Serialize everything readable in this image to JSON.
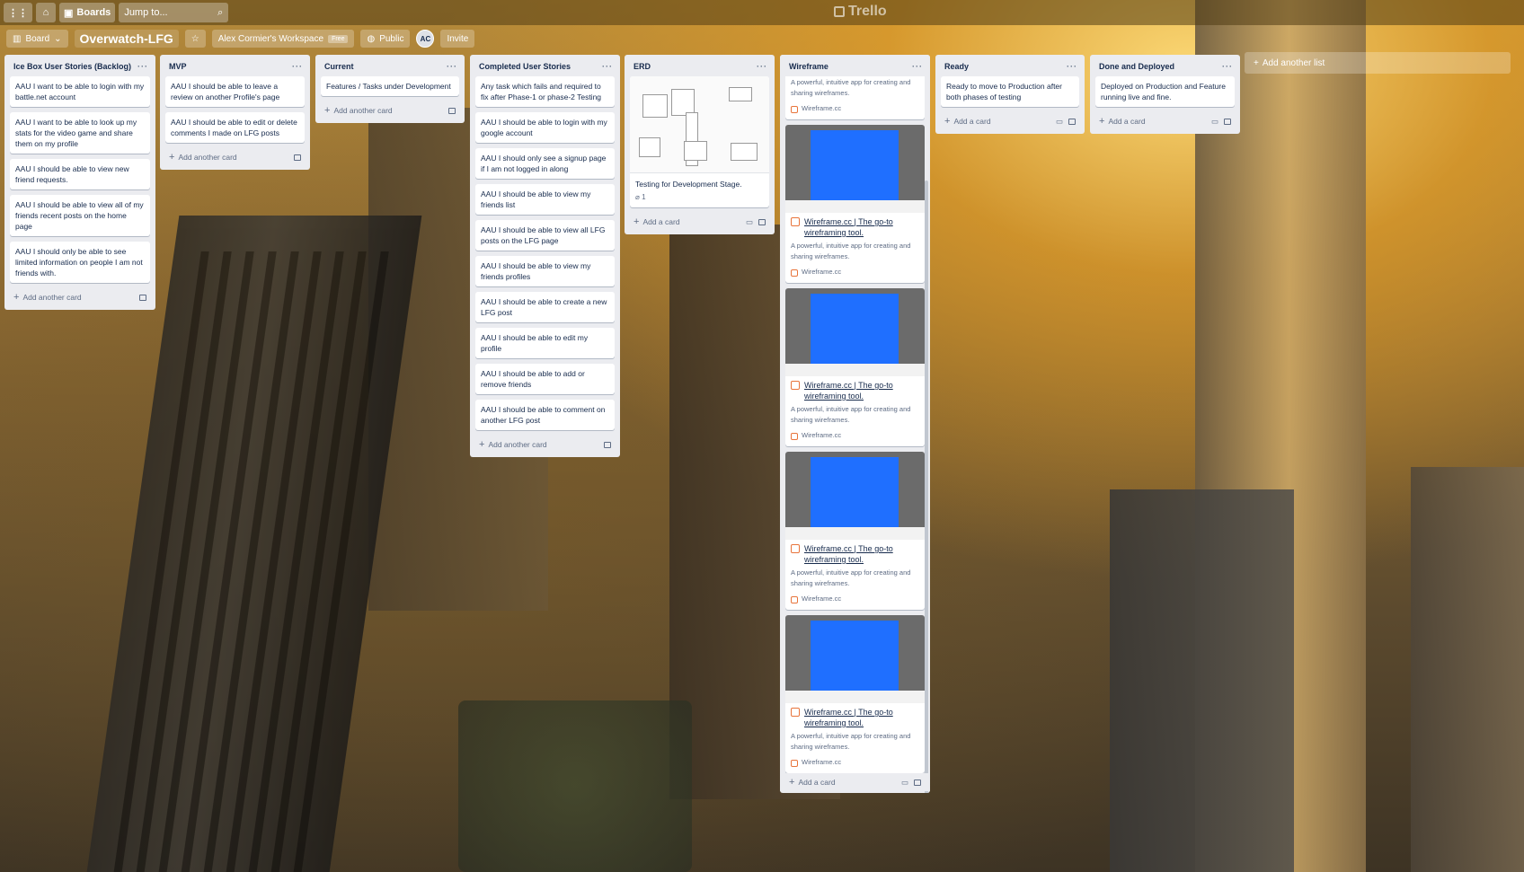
{
  "topnav": {
    "boards_label": "Boards",
    "search_placeholder": "Jump to...",
    "logo_text": "Trello"
  },
  "boardbar": {
    "view_label": "Board",
    "board_title": "Overwatch-LFG",
    "workspace_label": "Alex Cormier's Workspace",
    "workspace_badge": "Free",
    "visibility_label": "Public",
    "avatar_initials": "AC",
    "invite_label": "Invite"
  },
  "lists": [
    {
      "title": "Ice Box User Stories (Backlog)",
      "add_label": "Add another card",
      "cards": [
        "AAU I want to be able to login with my battle.net account",
        "AAU I want to be able to look up my stats for the video game and share them on my profile",
        "AAU I should be able to view new friend requests.",
        "AAU I should be able to view all of my friends recent posts on the home page",
        "AAU I should only be able to see limited information on people I am not friends with."
      ]
    },
    {
      "title": "MVP",
      "add_label": "Add another card",
      "cards": [
        "AAU I should be able to leave a review on another Profile's page",
        "AAU I should be able to edit or delete comments I made on LFG posts"
      ]
    },
    {
      "title": "Current",
      "add_label": "Add another card",
      "cards": [
        "Features / Tasks under Development"
      ]
    },
    {
      "title": "Completed User Stories",
      "add_label": "Add another card",
      "cards": [
        "Any task which fails and required to fix after Phase-1 or phase-2 Testing",
        "AAU I should be able to login with my google account",
        "AAU I should only see a signup page if I am not logged in along",
        "AAU I should be able to view my friends list",
        "AAU I should be able to view all LFG posts on the LFG page",
        "AAU I should be able to view my friends profiles",
        "AAU I should be able to create a new LFG post",
        "AAU I should be able to edit my profile",
        "AAU I should be able to add or remove friends",
        "AAU I should be able to comment on another LFG post"
      ]
    },
    {
      "title": "ERD",
      "add_label": "Add a card",
      "card_text": "Testing for Development Stage.",
      "attachment_count": "1"
    },
    {
      "title": "Wireframe",
      "add_label": "Add a card",
      "top_partial": {
        "desc": "A powerful, intuitive app for creating and sharing wireframes.",
        "site": "Wireframe.cc"
      },
      "cards": [
        {
          "title": "Wireframe.cc | The go-to wireframing tool.",
          "desc": "A powerful, intuitive app for creating and sharing wireframes.",
          "site": "Wireframe.cc"
        },
        {
          "title": "Wireframe.cc | The go-to wireframing tool.",
          "desc": "A powerful, intuitive app for creating and sharing wireframes.",
          "site": "Wireframe.cc"
        },
        {
          "title": "Wireframe.cc | The go-to wireframing tool.",
          "desc": "A powerful, intuitive app for creating and sharing wireframes.",
          "site": "Wireframe.cc"
        },
        {
          "title": "Wireframe.cc | The go-to wireframing tool.",
          "desc": "A powerful, intuitive app for creating and sharing wireframes.",
          "site": "Wireframe.cc"
        }
      ]
    },
    {
      "title": "Ready",
      "add_label": "Add a card",
      "cards": [
        "Ready to move to Production after both phases of testing"
      ]
    },
    {
      "title": "Done and Deployed",
      "add_label": "Add a card",
      "cards": [
        "Deployed on Production and Feature running live and fine."
      ]
    }
  ],
  "add_list_label": "Add another list"
}
